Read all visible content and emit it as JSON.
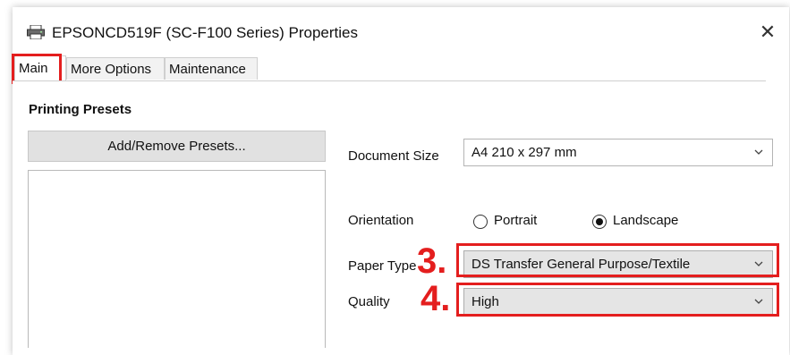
{
  "window": {
    "title": "EPSONCD519F (SC-F100 Series) Properties",
    "close_icon": "close-icon",
    "app_icon": "printer-icon"
  },
  "tabs": [
    {
      "label": "Main",
      "active": true
    },
    {
      "label": "More Options",
      "active": false
    },
    {
      "label": "Maintenance",
      "active": false
    }
  ],
  "presets": {
    "title": "Printing Presets",
    "button_label": "Add/Remove Presets..."
  },
  "settings": {
    "document_size": {
      "label": "Document Size",
      "value": "A4 210 x 297 mm"
    },
    "orientation": {
      "label": "Orientation",
      "options": [
        {
          "label": "Portrait",
          "checked": false
        },
        {
          "label": "Landscape",
          "checked": true
        }
      ]
    },
    "paper_type": {
      "label": "Paper Type",
      "value": "DS Transfer General Purpose/Textile"
    },
    "quality": {
      "label": "Quality",
      "value": "High"
    }
  },
  "annotations": {
    "step3": "3.",
    "step4": "4.",
    "highlight_color": "#e41e1e"
  }
}
